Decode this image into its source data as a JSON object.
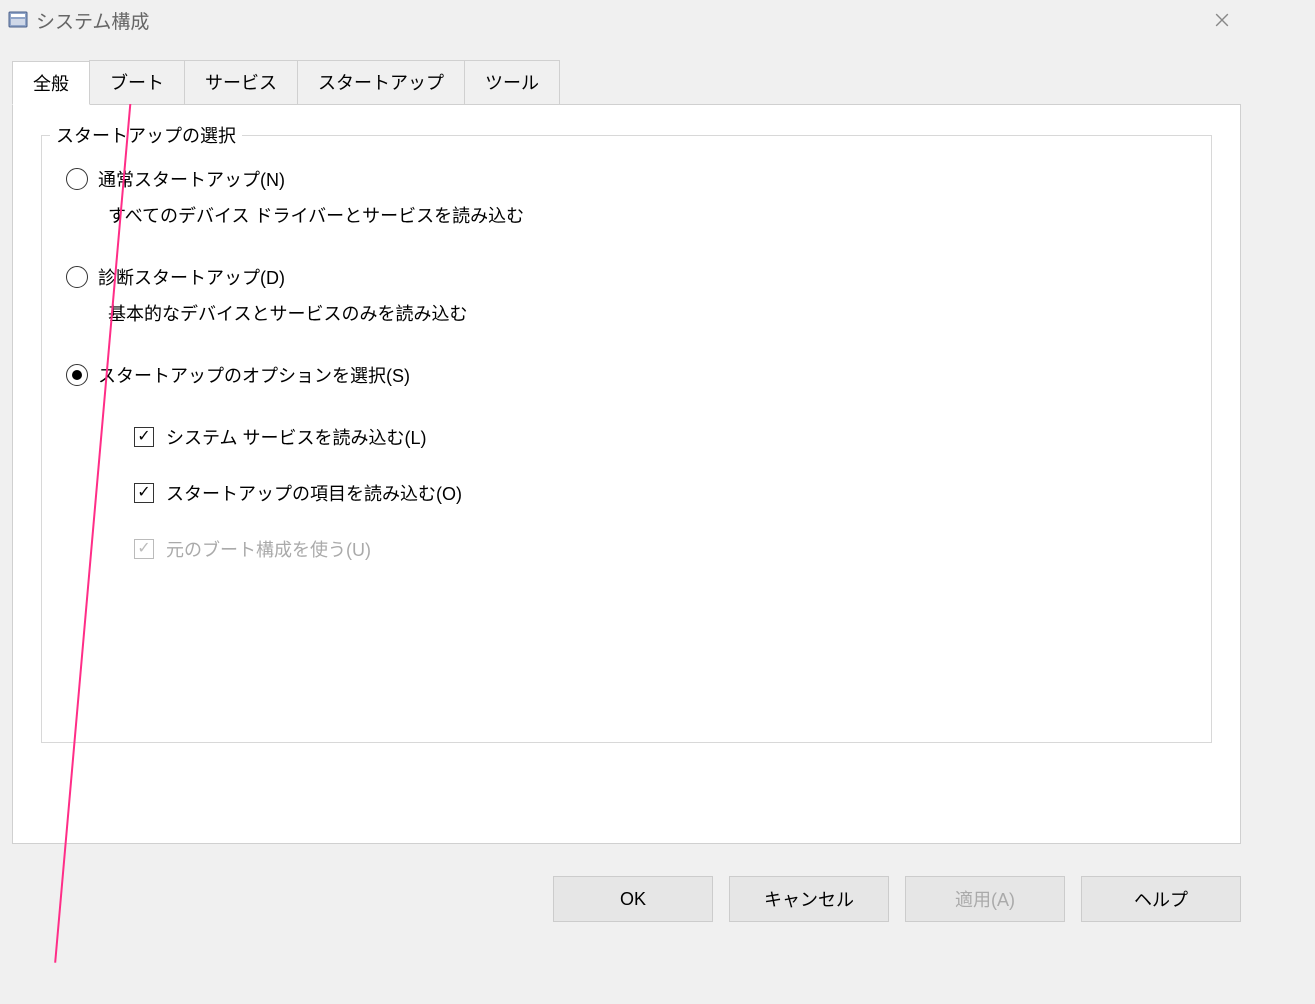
{
  "window": {
    "title": "システム構成"
  },
  "tabs": [
    {
      "label": "全般",
      "active": true
    },
    {
      "label": "ブート",
      "active": false
    },
    {
      "label": "サービス",
      "active": false
    },
    {
      "label": "スタートアップ",
      "active": false
    },
    {
      "label": "ツール",
      "active": false
    }
  ],
  "fieldset": {
    "legend": "スタートアップの選択",
    "options": [
      {
        "label": "通常スタートアップ(N)",
        "desc": "すべてのデバイス ドライバーとサービスを読み込む",
        "selected": false
      },
      {
        "label": "診断スタートアップ(D)",
        "desc": "基本的なデバイスとサービスのみを読み込む",
        "selected": false
      },
      {
        "label": "スタートアップのオプションを選択(S)",
        "desc": "",
        "selected": true
      }
    ],
    "checkboxes": [
      {
        "label": "システム サービスを読み込む(L)",
        "checked": true,
        "disabled": false
      },
      {
        "label": "スタートアップの項目を読み込む(O)",
        "checked": true,
        "disabled": false
      },
      {
        "label": "元のブート構成を使う(U)",
        "checked": true,
        "disabled": true
      }
    ]
  },
  "buttons": {
    "ok": "OK",
    "cancel": "キャンセル",
    "apply": "適用(A)",
    "help": "ヘルプ"
  }
}
